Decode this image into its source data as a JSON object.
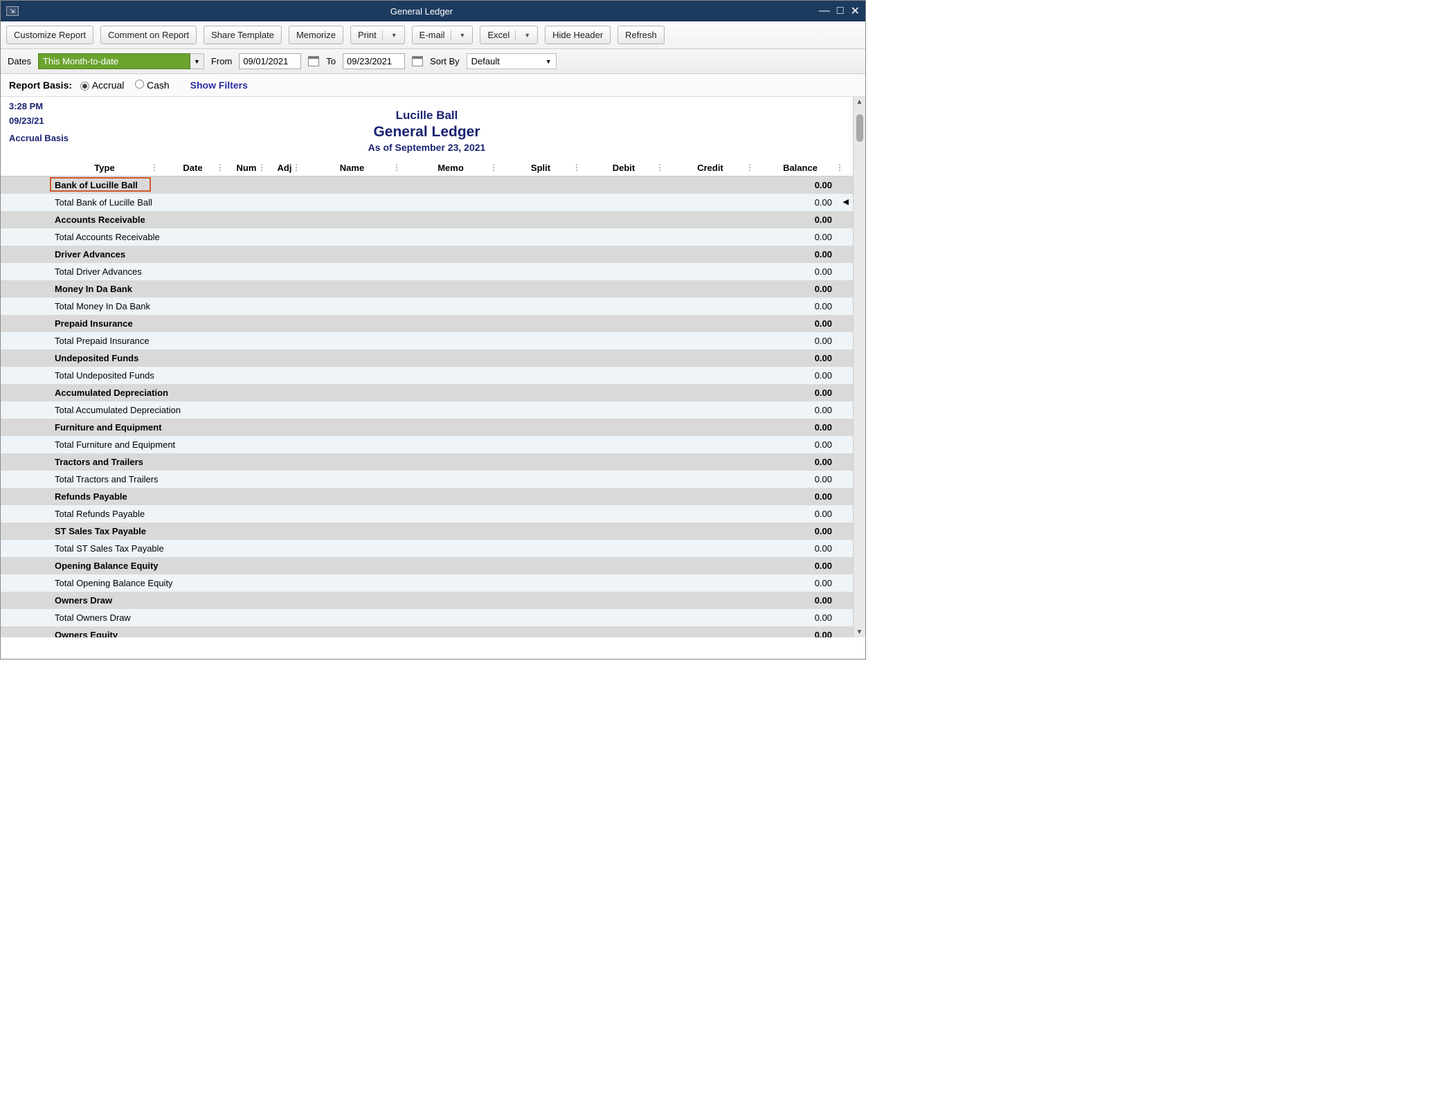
{
  "window": {
    "title": "General Ledger"
  },
  "toolbar": {
    "customize": "Customize Report",
    "comment": "Comment on Report",
    "share": "Share Template",
    "memorize": "Memorize",
    "print": "Print",
    "email": "E-mail",
    "excel": "Excel",
    "hideheader": "Hide Header",
    "refresh": "Refresh"
  },
  "dates": {
    "label": "Dates",
    "range": "This Month-to-date",
    "from_label": "From",
    "from": "09/01/2021",
    "to_label": "To",
    "to": "09/23/2021",
    "sort_label": "Sort By",
    "sort": "Default"
  },
  "basis": {
    "label": "Report Basis:",
    "accrual": "Accrual",
    "cash": "Cash",
    "show_filters": "Show Filters"
  },
  "meta": {
    "time": "3:28 PM",
    "date": "09/23/21",
    "basis": "Accrual Basis"
  },
  "report": {
    "company": "Lucille Ball",
    "name": "General Ledger",
    "asof": "As of September 23, 2021"
  },
  "columns": {
    "type": "Type",
    "date": "Date",
    "num": "Num",
    "adj": "Adj",
    "name": "Name",
    "memo": "Memo",
    "split": "Split",
    "debit": "Debit",
    "credit": "Credit",
    "balance": "Balance"
  },
  "rows": [
    {
      "kind": "header",
      "label": "Bank of Lucille Ball",
      "balance": "0.00"
    },
    {
      "kind": "total",
      "label": "Total Bank of Lucille Ball",
      "balance": "0.00"
    },
    {
      "kind": "header",
      "label": "Accounts Receivable",
      "balance": "0.00"
    },
    {
      "kind": "total",
      "label": "Total Accounts Receivable",
      "balance": "0.00"
    },
    {
      "kind": "header",
      "label": "Driver Advances",
      "balance": "0.00"
    },
    {
      "kind": "total",
      "label": "Total Driver Advances",
      "balance": "0.00"
    },
    {
      "kind": "header",
      "label": "Money In Da Bank",
      "balance": "0.00"
    },
    {
      "kind": "total",
      "label": "Total Money In Da Bank",
      "balance": "0.00"
    },
    {
      "kind": "header",
      "label": "Prepaid Insurance",
      "balance": "0.00"
    },
    {
      "kind": "total",
      "label": "Total Prepaid Insurance",
      "balance": "0.00"
    },
    {
      "kind": "header",
      "label": "Undeposited Funds",
      "balance": "0.00"
    },
    {
      "kind": "total",
      "label": "Total Undeposited Funds",
      "balance": "0.00"
    },
    {
      "kind": "header",
      "label": "Accumulated Depreciation",
      "balance": "0.00"
    },
    {
      "kind": "total",
      "label": "Total Accumulated Depreciation",
      "balance": "0.00"
    },
    {
      "kind": "header",
      "label": "Furniture and Equipment",
      "balance": "0.00"
    },
    {
      "kind": "total",
      "label": "Total Furniture and Equipment",
      "balance": "0.00"
    },
    {
      "kind": "header",
      "label": "Tractors and Trailers",
      "balance": "0.00"
    },
    {
      "kind": "total",
      "label": "Total Tractors and Trailers",
      "balance": "0.00"
    },
    {
      "kind": "header",
      "label": "Refunds Payable",
      "balance": "0.00"
    },
    {
      "kind": "total",
      "label": "Total Refunds Payable",
      "balance": "0.00"
    },
    {
      "kind": "header",
      "label": "ST Sales Tax Payable",
      "balance": "0.00"
    },
    {
      "kind": "total",
      "label": "Total ST Sales Tax Payable",
      "balance": "0.00"
    },
    {
      "kind": "header",
      "label": "Opening Balance Equity",
      "balance": "0.00"
    },
    {
      "kind": "total",
      "label": "Total Opening Balance Equity",
      "balance": "0.00"
    },
    {
      "kind": "header",
      "label": "Owners Draw",
      "balance": "0.00"
    },
    {
      "kind": "total",
      "label": "Total Owners Draw",
      "balance": "0.00"
    },
    {
      "kind": "header",
      "label": "Owners Equity",
      "balance": "0.00"
    }
  ]
}
